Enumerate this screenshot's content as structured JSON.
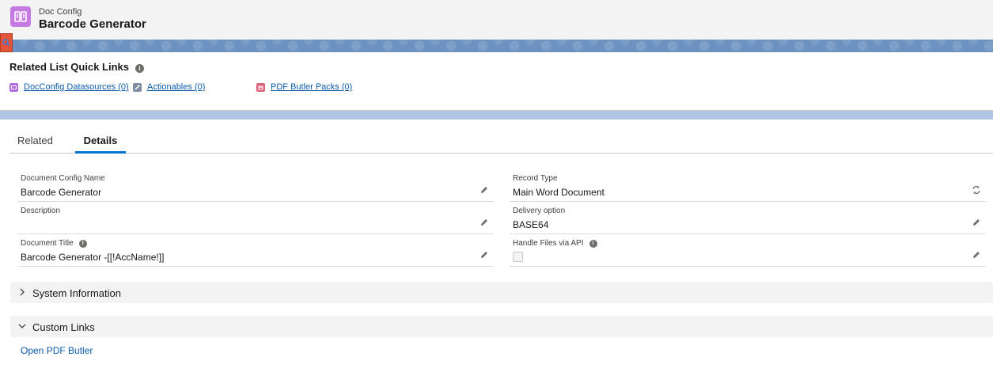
{
  "header": {
    "object_type": "Doc Config",
    "record_name": "Barcode Generator",
    "icon": "doc-config-icon",
    "icon_color": "#c47ae0"
  },
  "quick_links": {
    "heading": "Related List Quick Links",
    "links": [
      {
        "label": "DocConfig Datasources (0)",
        "icon": "datasource-icon",
        "icon_color": "#b36be0"
      },
      {
        "label": "Actionables (0)",
        "icon": "wrench-icon",
        "icon_color": "#7f8ea5"
      },
      {
        "label": "PDF Butler Packs (0)",
        "icon": "pack-icon",
        "icon_color": "#e0627a"
      }
    ]
  },
  "tabs": {
    "related": "Related",
    "details": "Details",
    "active": "Details"
  },
  "fields": {
    "document_config_name": {
      "label": "Document Config Name",
      "value": "Barcode Generator"
    },
    "record_type": {
      "label": "Record Type",
      "value": "Main Word Document"
    },
    "description": {
      "label": "Description",
      "value": ""
    },
    "delivery_option": {
      "label": "Delivery option",
      "value": "BASE64"
    },
    "document_title": {
      "label": "Document Title",
      "value": "Barcode Generator -[[!AccName!]]"
    },
    "handle_files_via_api": {
      "label": "Handle Files via API",
      "checked": false
    }
  },
  "sections": {
    "system_information": {
      "title": "System Information",
      "expanded": false
    },
    "custom_links": {
      "title": "Custom Links",
      "expanded": true,
      "links": [
        "Open PDF Butler"
      ]
    }
  },
  "colors": {
    "link": "#0b5cab",
    "active_tab": "#0176d3",
    "banner": "#6b92c0"
  }
}
